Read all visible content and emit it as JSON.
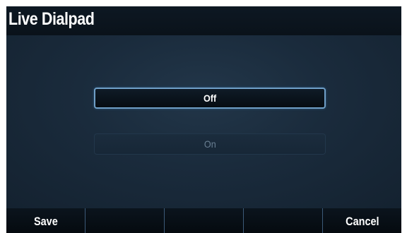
{
  "title": "Live Dialpad",
  "options": [
    {
      "label": "Off",
      "selected": true
    },
    {
      "label": "On",
      "selected": false
    }
  ],
  "softkeys": [
    "Save",
    "",
    "",
    "",
    "Cancel"
  ],
  "colors": {
    "background": "#152331",
    "title_bar": "#0b151f",
    "selected_border": "#6f9fc7",
    "unselected_text": "#6a7f93",
    "softkey_divider": "#3c5a78"
  }
}
